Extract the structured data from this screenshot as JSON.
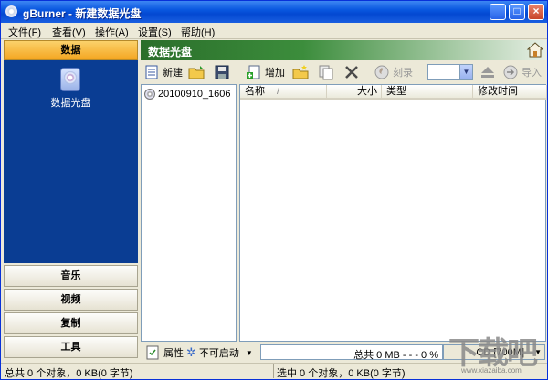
{
  "window": {
    "title": "gBurner - 新建数据光盘"
  },
  "menu": [
    {
      "label": "文件(F)"
    },
    {
      "label": "查看(V)"
    },
    {
      "label": "操作(A)"
    },
    {
      "label": "设置(S)"
    },
    {
      "label": "帮助(H)"
    }
  ],
  "sidebar": {
    "header": "数据",
    "item_label": "数据光盘",
    "buttons": [
      {
        "label": "音乐"
      },
      {
        "label": "视频"
      },
      {
        "label": "复制"
      },
      {
        "label": "工具"
      }
    ]
  },
  "main": {
    "header_title": "数据光盘",
    "toolbar": {
      "new_label": "新建",
      "add_label": "增加",
      "burn_label": "刻录",
      "import_label": "导入"
    },
    "tree": {
      "root_label": "20100910_1606"
    },
    "columns": [
      {
        "label": "名称"
      },
      {
        "label": "大小"
      },
      {
        "label": "类型"
      },
      {
        "label": "修改时间"
      }
    ],
    "bottom": {
      "properties_label": "属性",
      "boot_label": "不可启动",
      "capacity_text": "总共 0 MB   - - -  0 %",
      "capacity_percent": 0,
      "disc_type": "CD [700M]"
    }
  },
  "status": {
    "left": "总共 0 个对象，0 KB(0 字节)",
    "right": "选中 0 个对象，0 KB(0 字节)"
  },
  "watermark": {
    "text": "下载吧",
    "sub": "www.xiazaiba.com"
  },
  "colors": {
    "title_bar": "#0a58e0",
    "sidebar_panel": "#0a3d93",
    "sidebar_header": "#f4a621",
    "header_green": "#2a6e2a"
  }
}
